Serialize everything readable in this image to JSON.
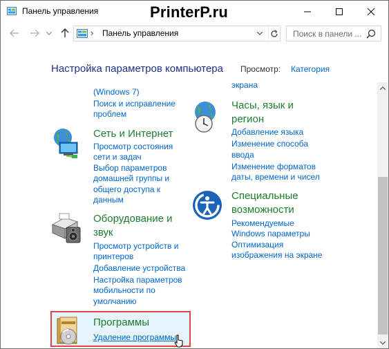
{
  "window": {
    "title": "Панель управления",
    "watermark": "PrinterP.ru"
  },
  "address": {
    "path": "Панель управления",
    "separator": "›",
    "search_placeholder": "Поиск в панели ..."
  },
  "header": {
    "title": "Настройка параметров компьютера",
    "view_label": "Просмотр:",
    "view_value": "Категория"
  },
  "categories": {
    "security_tail": {
      "lines": [
        "(Windows 7)",
        "Поиск и исправление",
        "проблем"
      ]
    },
    "network": {
      "title": "Сеть и Интернет",
      "links": [
        "Просмотр состояния",
        "сети и задач",
        "Выбор параметров",
        "домашней группы и",
        "общего доступа к",
        "данным"
      ]
    },
    "hardware": {
      "title_line1": "Оборудование и",
      "title_line2": "звук",
      "links": [
        "Просмотр устройств и",
        "принтеров",
        "Добавление устройства",
        "Настройка параметров",
        "мобильности по",
        "умолчанию"
      ]
    },
    "programs": {
      "title": "Программы",
      "link": "Удаление программы"
    },
    "appearance_tail": {
      "text": "экрана"
    },
    "clock": {
      "title_line1": "Часы, язык и",
      "title_line2": "регион",
      "links": [
        "Добавление языка",
        "Изменение способа",
        "ввода",
        "Изменение форматов",
        "даты, времени и чисел"
      ]
    },
    "ease": {
      "title_line1": "Специальные",
      "title_line2": "возможности",
      "links": [
        "Рекомендуемые",
        "Windows параметры",
        "Оптимизация",
        "изображения на экране"
      ]
    }
  },
  "colors": {
    "category_title": "#1d7d2f",
    "link": "#0066cc",
    "header": "#1e3287",
    "highlight_border": "#e04848",
    "highlight_bg": "#e5f3fb"
  },
  "icons": [
    "control-panel-icon",
    "minimize-icon",
    "maximize-icon",
    "close-icon",
    "back-arrow-icon",
    "forward-arrow-icon",
    "dropdown-icon",
    "up-arrow-icon",
    "chevron-down-icon",
    "refresh-icon",
    "search-icon",
    "network-globe-icon",
    "printer-speaker-icon",
    "programs-disc-icon",
    "clock-globe-icon",
    "accessibility-icon",
    "mouse-cursor-icon",
    "scroll-up-icon",
    "scroll-down-icon"
  ]
}
